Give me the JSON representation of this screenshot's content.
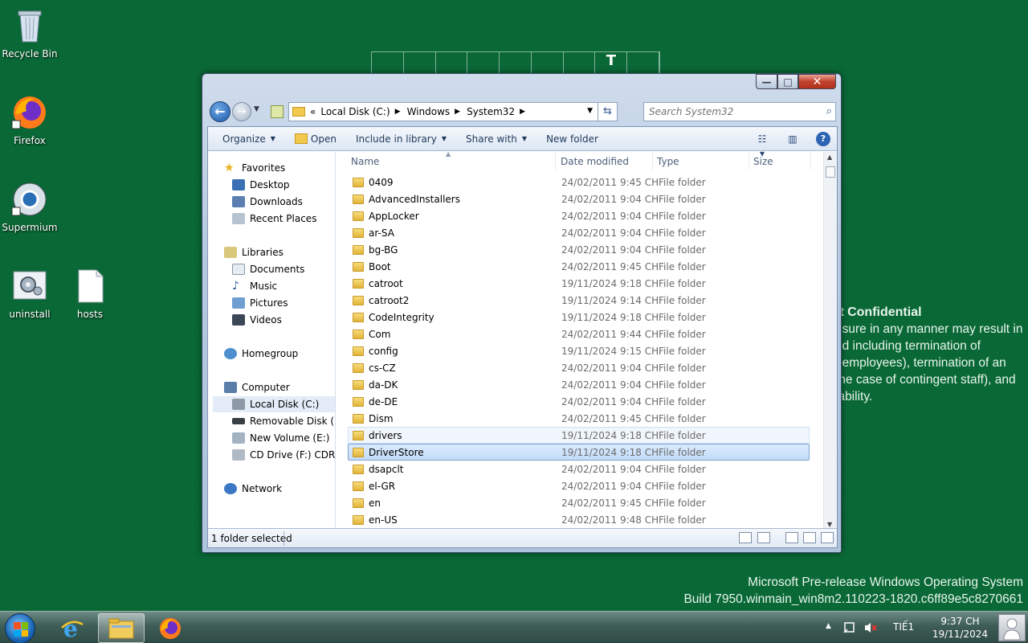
{
  "desktop": {
    "icons": [
      {
        "label": "Recycle Bin",
        "icon": "recycle-bin-icon"
      },
      {
        "label": "Firefox",
        "icon": "firefox-icon"
      },
      {
        "label": "Supermium",
        "icon": "supermium-icon"
      },
      {
        "label": "uninstall",
        "icon": "settings-file-icon"
      },
      {
        "label": "hosts",
        "icon": "file-icon"
      }
    ],
    "bg_letter": "T",
    "confidential": {
      "title": "ft Confidential",
      "lines": [
        "osure in any manner may result in",
        "nd including termination of",
        "f employees), termination of an",
        "the case of contingent staff), and",
        "iability."
      ]
    },
    "build": {
      "line1": "Microsoft Pre-release Windows Operating System",
      "line2": "Build 7950.winmain_win8m2.110223-1820.c6ff89e5c8270661"
    }
  },
  "window": {
    "caption": {
      "minimize": "—",
      "maximize": "□",
      "close": "✕"
    },
    "nav": {
      "back": "←",
      "forward": "→"
    },
    "address": {
      "overflow": "«",
      "crumbs": [
        "Local Disk (C:)",
        "Windows",
        "System32"
      ]
    },
    "search": {
      "placeholder": "Search System32"
    },
    "toolbar": {
      "organize": "Organize",
      "open": "Open",
      "include": "Include in library",
      "share": "Share with",
      "new_folder": "New folder"
    },
    "nav_pane": {
      "favorites": "Favorites",
      "desktop": "Desktop",
      "downloads": "Downloads",
      "recent": "Recent Places",
      "libraries": "Libraries",
      "documents": "Documents",
      "music": "Music",
      "pictures": "Pictures",
      "videos": "Videos",
      "homegroup": "Homegroup",
      "computer": "Computer",
      "local_disk": "Local Disk (C:)",
      "removable": "Removable Disk (D:)",
      "new_volume": "New Volume (E:)",
      "cd_drive": "CD Drive (F:) CDROM",
      "network": "Network"
    },
    "columns": {
      "name": "Name",
      "date": "Date modified",
      "type": "Type",
      "size": "Size"
    },
    "files": [
      {
        "name": "0409",
        "date": "24/02/2011 9:45 CH",
        "type": "File folder"
      },
      {
        "name": "AdvancedInstallers",
        "date": "24/02/2011 9:04 CH",
        "type": "File folder"
      },
      {
        "name": "AppLocker",
        "date": "24/02/2011 9:04 CH",
        "type": "File folder"
      },
      {
        "name": "ar-SA",
        "date": "24/02/2011 9:04 CH",
        "type": "File folder"
      },
      {
        "name": "bg-BG",
        "date": "24/02/2011 9:04 CH",
        "type": "File folder"
      },
      {
        "name": "Boot",
        "date": "24/02/2011 9:45 CH",
        "type": "File folder"
      },
      {
        "name": "catroot",
        "date": "19/11/2024 9:18 CH",
        "type": "File folder"
      },
      {
        "name": "catroot2",
        "date": "19/11/2024 9:14 CH",
        "type": "File folder"
      },
      {
        "name": "CodeIntegrity",
        "date": "19/11/2024 9:18 CH",
        "type": "File folder"
      },
      {
        "name": "Com",
        "date": "24/02/2011 9:44 CH",
        "type": "File folder"
      },
      {
        "name": "config",
        "date": "19/11/2024 9:15 CH",
        "type": "File folder"
      },
      {
        "name": "cs-CZ",
        "date": "24/02/2011 9:04 CH",
        "type": "File folder"
      },
      {
        "name": "da-DK",
        "date": "24/02/2011 9:04 CH",
        "type": "File folder"
      },
      {
        "name": "de-DE",
        "date": "24/02/2011 9:04 CH",
        "type": "File folder"
      },
      {
        "name": "Dism",
        "date": "24/02/2011 9:45 CH",
        "type": "File folder"
      },
      {
        "name": "drivers",
        "date": "19/11/2024 9:18 CH",
        "type": "File folder"
      },
      {
        "name": "DriverStore",
        "date": "19/11/2024 9:18 CH",
        "type": "File folder"
      },
      {
        "name": "dsapclt",
        "date": "24/02/2011 9:04 CH",
        "type": "File folder"
      },
      {
        "name": "el-GR",
        "date": "24/02/2011 9:04 CH",
        "type": "File folder"
      },
      {
        "name": "en",
        "date": "24/02/2011 9:45 CH",
        "type": "File folder"
      },
      {
        "name": "en-US",
        "date": "24/02/2011 9:48 CH",
        "type": "File folder"
      }
    ],
    "status": {
      "text": "1 folder selected"
    }
  },
  "taskbar": {
    "lang": "TIẾ1",
    "time": "9:37 CH",
    "date": "19/11/2024",
    "tray_up": "▲"
  },
  "colors": {
    "desktop": "#0a6a37",
    "selection": "#c3dcf8",
    "accent": "#1e395b"
  }
}
